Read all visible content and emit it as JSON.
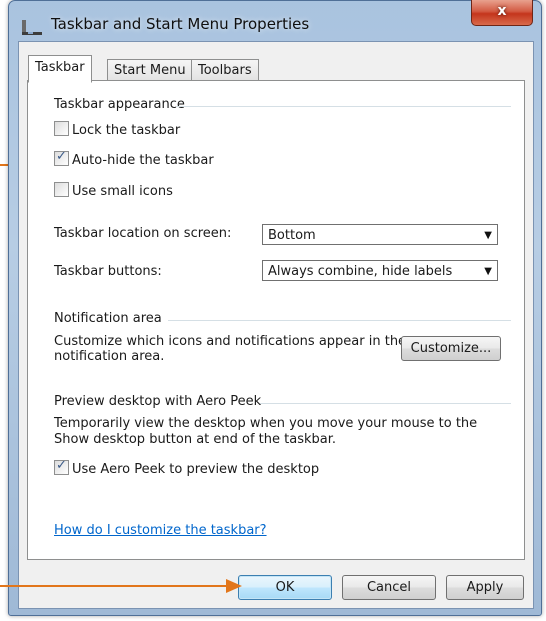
{
  "window": {
    "title": "Taskbar and Start Menu Properties",
    "close_glyph": "x"
  },
  "tabs": [
    "Taskbar",
    "Start Menu",
    "Toolbars"
  ],
  "appearance": {
    "heading": "Taskbar appearance",
    "lock_label": "Lock the taskbar",
    "lock_checked": false,
    "autohide_label": "Auto-hide the taskbar",
    "autohide_checked": true,
    "small_icons_label": "Use small icons",
    "small_icons_checked": false,
    "location_label": "Taskbar location on screen:",
    "location_value": "Bottom",
    "buttons_label": "Taskbar buttons:",
    "buttons_value": "Always combine, hide labels"
  },
  "notification": {
    "heading": "Notification area",
    "text_line1": "Customize which icons and notifications appear in the",
    "text_line2": "notification area.",
    "customize_button": "Customize..."
  },
  "aero": {
    "heading": "Preview desktop with Aero Peek",
    "text_line1": "Temporarily view the desktop when you move your mouse to the",
    "text_line2": "Show desktop button at end of the taskbar.",
    "peek_label": "Use Aero Peek to preview the desktop",
    "peek_checked": true
  },
  "help_link": "How do I customize the taskbar?",
  "buttons": {
    "ok": "OK",
    "cancel": "Cancel",
    "apply": "Apply"
  },
  "check_glyph": "✓",
  "colors": {
    "annotation_arrow": "#e2761b",
    "link": "#0066cc"
  }
}
